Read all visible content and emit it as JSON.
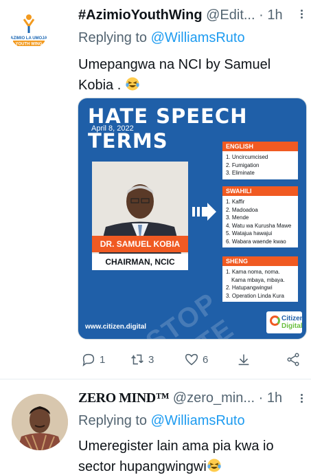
{
  "tweets": [
    {
      "avatar": {
        "line1": "AZIMIO LA UMOJA",
        "line2": "YOUTH WING"
      },
      "display_name": "#AzimioYouthWing",
      "handle": "@Edit...",
      "separator": "·",
      "time": "1h",
      "reply_prefix": "Replying to",
      "reply_to": "@WilliamsRuto",
      "text": "Umepangwa na NCI by Samuel Kobia . ",
      "emoji": "laughing-tears",
      "media": {
        "title": "HATE SPEECH TERMS",
        "date": "April 8, 2022",
        "person_name": "DR. SAMUEL KOBIA",
        "person_title": "CHAIRMAN, NCIC",
        "watermark": "STOP HATE",
        "url": "www.citizen.digital",
        "logo_line1": "Citizen",
        "logo_line2": "Digital",
        "sections": [
          {
            "heading": "ENGLISH",
            "items": [
              "1. Uncircumcised",
              "2. Fumigation",
              "3. Eliminate"
            ]
          },
          {
            "heading": "SWAHILI",
            "items": [
              "1. Kaffir",
              "2. Madoadoa",
              "3. Mende",
              "4. Watu wa Kurusha Mawe",
              "5. Watajua hawajui",
              "6. Wabara waende kwao"
            ]
          },
          {
            "heading": "SHENG",
            "items": [
              "1. Kama noma, noma.",
              "Kama mbaya, mbaya.",
              "2. Hatupangwingwi",
              "3. Operation Linda Kura"
            ]
          }
        ],
        "colors": {
          "background": "#1f5fa8",
          "accent": "#f05a22"
        }
      },
      "actions": {
        "replies": "1",
        "retweets": "3",
        "likes": "6"
      }
    },
    {
      "display_name": "ZERO MIND™",
      "handle": "@zero_min...",
      "separator": "·",
      "time": "1h",
      "reply_prefix": "Replying to",
      "reply_to": "@WilliamsRuto",
      "text": "Umeregister lain ama pia kwa io sector hupangwingwi",
      "emoji": "laughing-tears"
    }
  ],
  "colors": {
    "link": "#1d9bf0",
    "muted": "#536471",
    "text": "#0f1419"
  }
}
